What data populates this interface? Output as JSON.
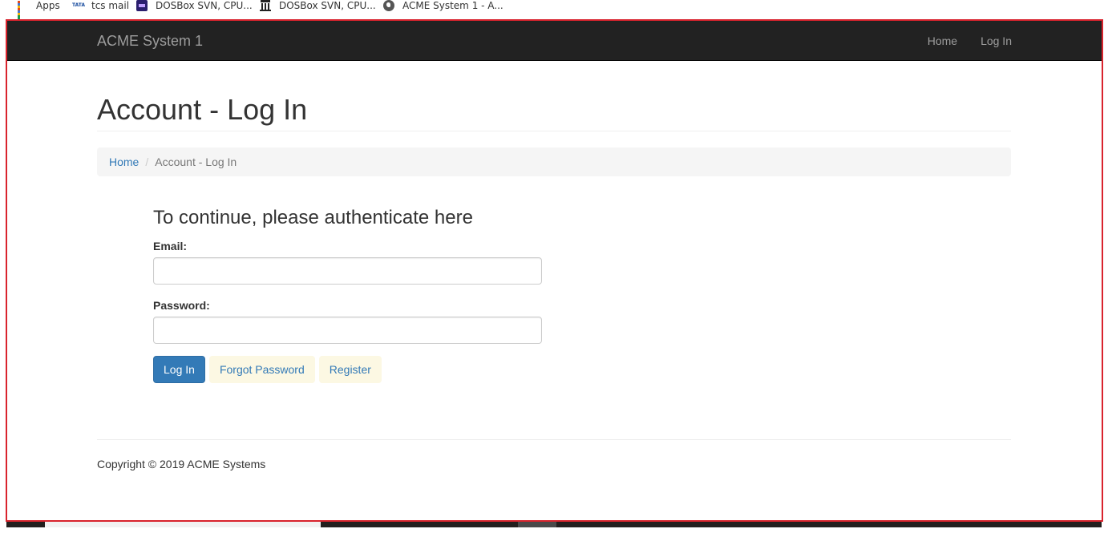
{
  "bookmarks": [
    {
      "label": "Apps",
      "icon": "apps-grid-icon"
    },
    {
      "label": "tcs mail",
      "icon": "tata-icon"
    },
    {
      "label": "DOSBox SVN, CPU...",
      "icon": "dosbox-icon"
    },
    {
      "label": "DOSBox SVN, CPU...",
      "icon": "bank-icon"
    },
    {
      "label": "ACME System 1 - A...",
      "icon": "globe-icon"
    }
  ],
  "navbar": {
    "brand": "ACME System 1",
    "links": [
      "Home",
      "Log In"
    ]
  },
  "page": {
    "title": "Account - Log In"
  },
  "breadcrumb": {
    "home": "Home",
    "separator": "/",
    "current": "Account - Log In"
  },
  "login_form": {
    "heading": "To continue, please authenticate here",
    "email_label": "Email:",
    "email_value": "",
    "password_label": "Password:",
    "password_value": "",
    "login_button": "Log In",
    "forgot_button": "Forgot Password",
    "register_button": "Register"
  },
  "footer": {
    "copyright": "Copyright © 2019 ACME Systems"
  },
  "colors": {
    "navbar_bg": "#222222",
    "link": "#337ab7",
    "primary_button": "#337ab7",
    "link_button_bg": "#fcf8e3",
    "highlight_border": "#d9232d"
  }
}
